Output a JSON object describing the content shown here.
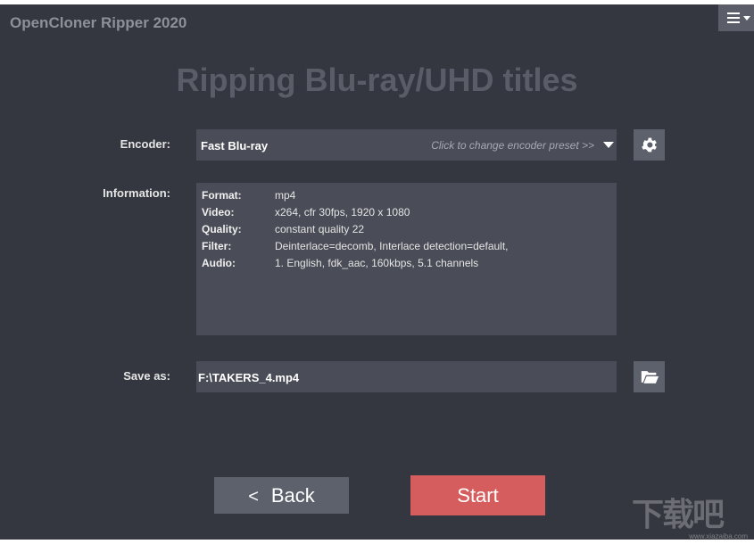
{
  "window": {
    "title": "OpenCloner Ripper 2020"
  },
  "header": {
    "menu_icon": "hamburger-menu-icon"
  },
  "page": {
    "title": "Ripping Blu-ray/UHD titles"
  },
  "encoder": {
    "label": "Encoder:",
    "value": "Fast Blu-ray",
    "hint": "Click to change encoder preset >>",
    "settings_icon": "gear-icon"
  },
  "information": {
    "label": "Information:",
    "rows": [
      {
        "key": "Format:",
        "value": "mp4"
      },
      {
        "key": "Video:",
        "value": "x264, cfr 30fps, 1920 x 1080"
      },
      {
        "key": "Quality:",
        "value": "constant quality 22"
      },
      {
        "key": "Filter:",
        "value": "Deinterlace=decomb, Interlace detection=default,"
      },
      {
        "key": "Audio:",
        "value": "1. English, fdk_aac, 160kbps, 5.1 channels"
      }
    ]
  },
  "save": {
    "label": "Save as:",
    "value": "F:\\TAKERS_4.mp4",
    "browse_icon": "folder-open-icon"
  },
  "buttons": {
    "back_arrow": "<",
    "back_label": "Back",
    "start_label": "Start"
  },
  "watermark": {
    "big": "下载吧",
    "small": "www.xiazaiba.com"
  },
  "colors": {
    "background": "#343740",
    "field": "#4a4d57",
    "button": "#5d616c",
    "start": "#d65d5d"
  }
}
